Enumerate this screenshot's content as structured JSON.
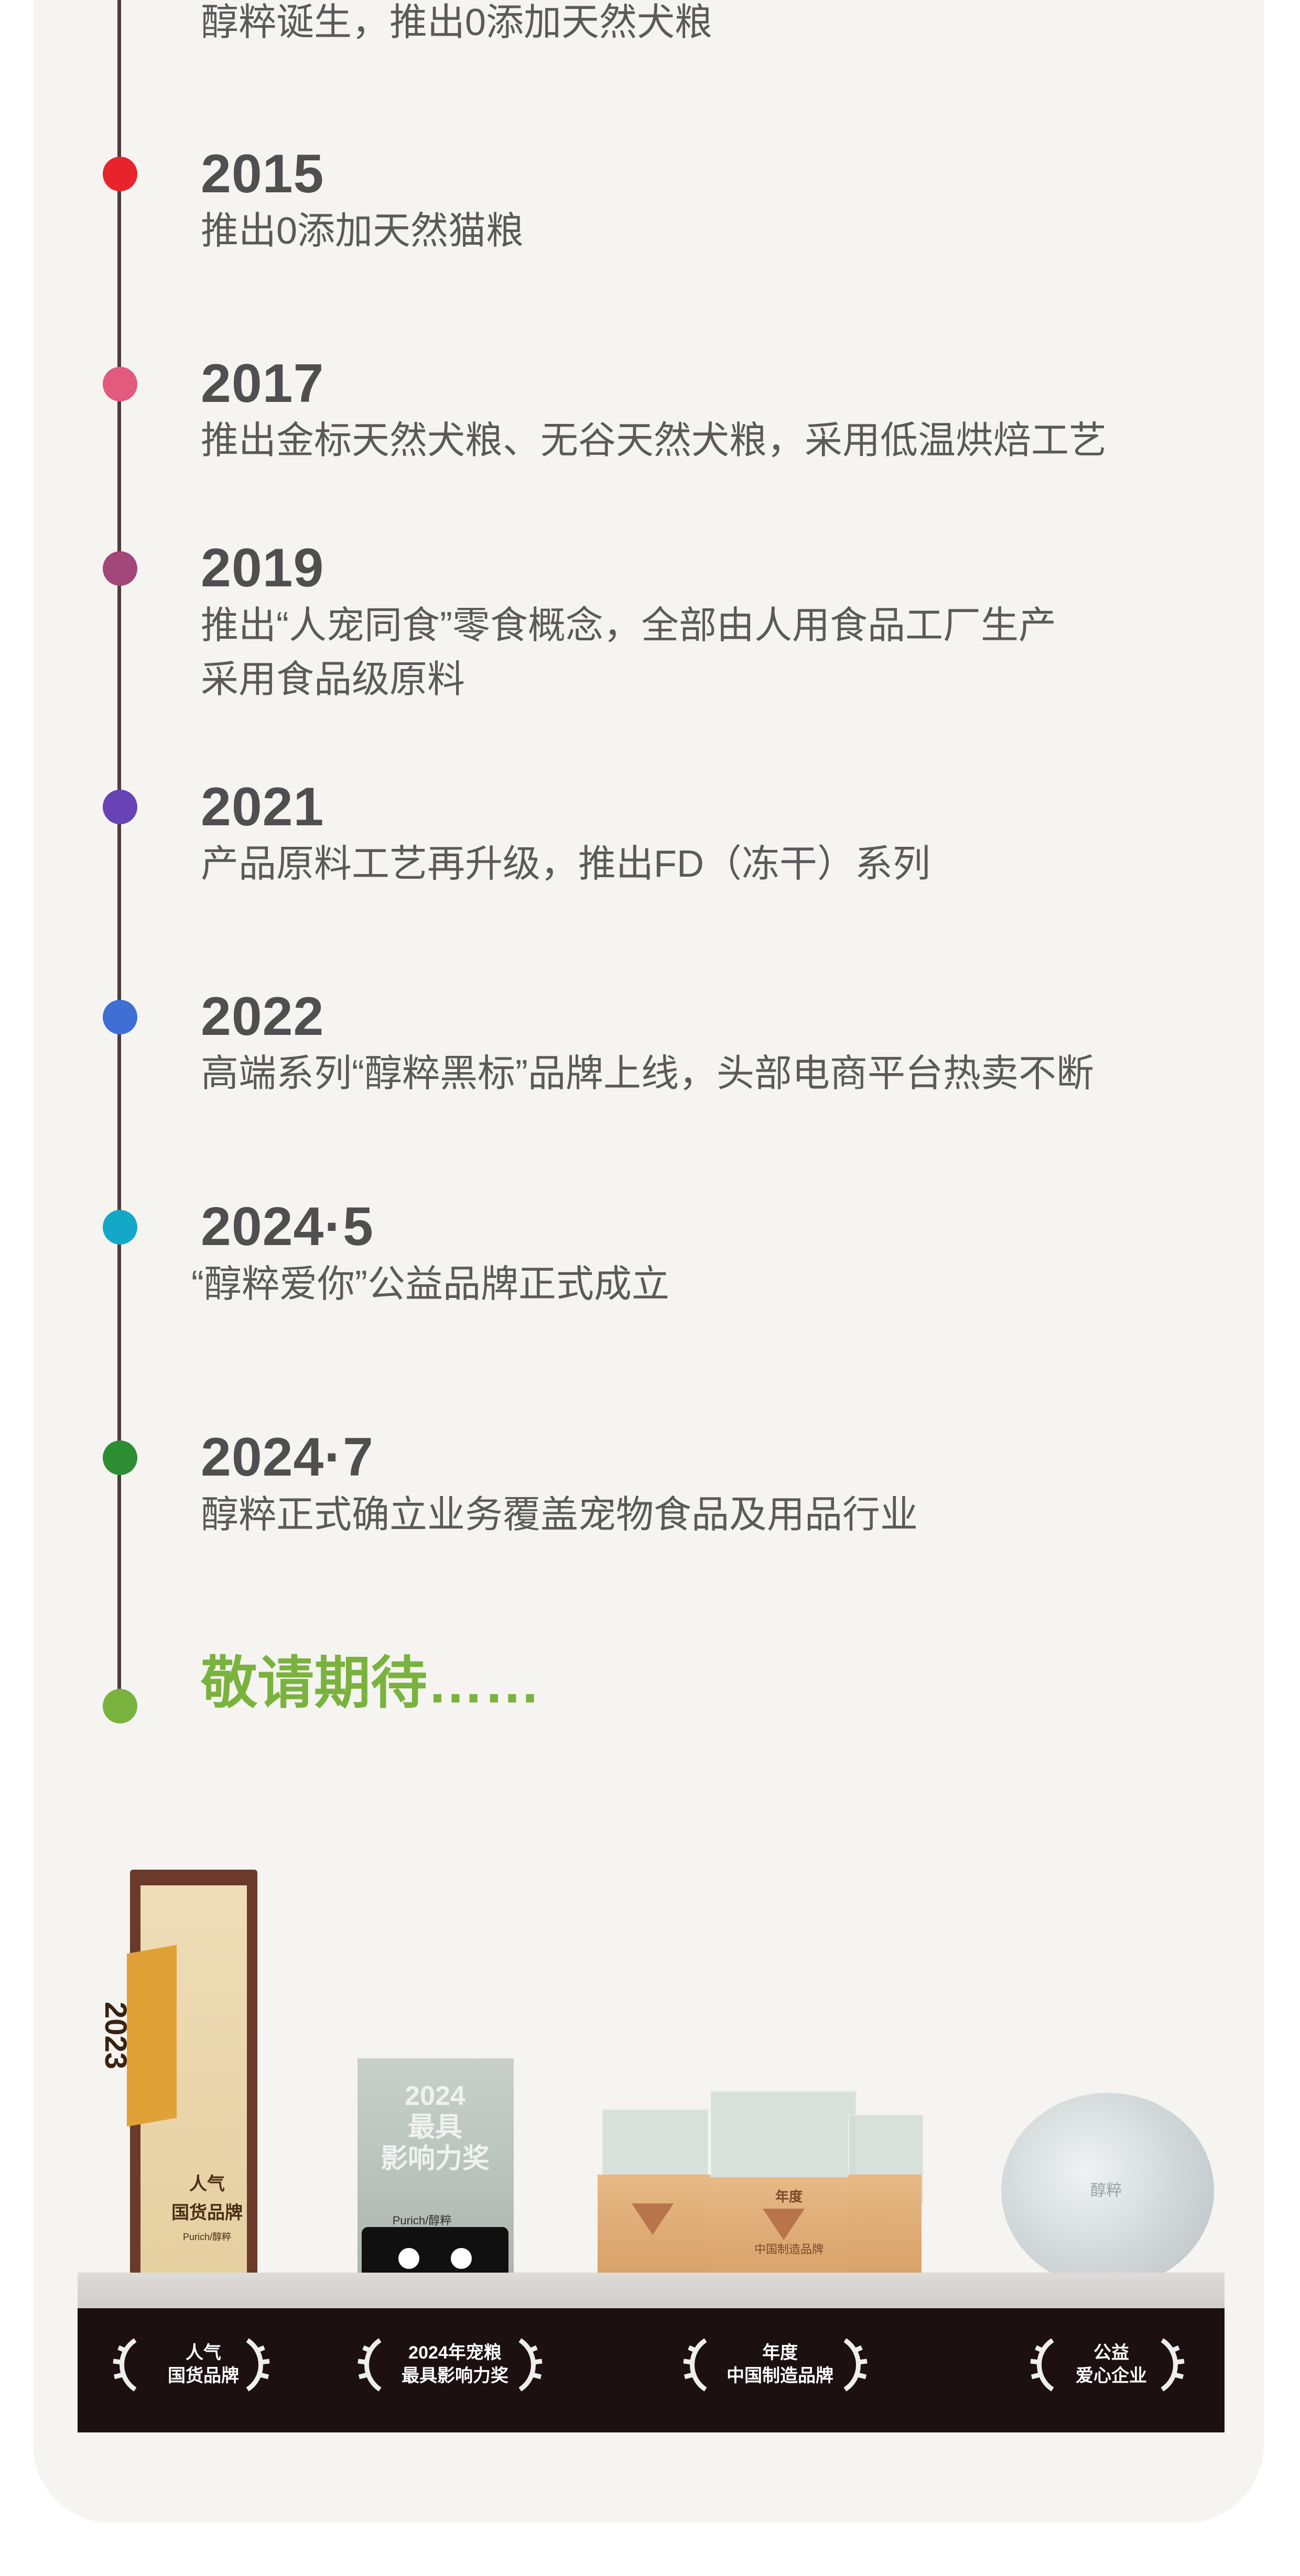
{
  "timeline": [
    {
      "year": "",
      "desc": "醇粹诞生，推出0添加天然犬粮",
      "color": ""
    },
    {
      "year": "2015",
      "desc": "推出0添加天然猫粮",
      "color": "#e8232c"
    },
    {
      "year": "2017",
      "desc": "推出金标天然犬粮、无谷天然犬粮，采用低温烘焙工艺",
      "color": "#e25a7e"
    },
    {
      "year": "2019",
      "desc": "推出“人宠同食”零食概念，全部由人用食品工厂生产",
      "desc2": "采用食品级原料",
      "color": "#a3477a"
    },
    {
      "year": "2021",
      "desc": "产品原料工艺再升级，推出FD（冻干）系列",
      "color": "#6743b6"
    },
    {
      "year": "2022",
      "desc": "高端系列“醇粹黑标”品牌上线，头部电商平台热卖不断",
      "color": "#3f6fd5"
    },
    {
      "year": "2024·5",
      "desc": "“醇粹爱你”公益品牌正式成立",
      "color": "#13a8c8"
    },
    {
      "year": "2024·7",
      "desc": "醇粹正式确立业务覆盖宠物食品及用品行业",
      "color": "#2d8d33"
    }
  ],
  "final": {
    "text": "敬请期待……",
    "color": "#7ab23e"
  },
  "trophies": {
    "t1": {
      "year": "2023",
      "line1": "人气",
      "line2": "国货品牌",
      "brand": "Purich/醇粹"
    },
    "t2": {
      "year": "2024",
      "line1": "最具",
      "line2": "影响力奖",
      "brand": "Purich/醇粹"
    },
    "t3": {
      "line1": "年度",
      "line2": "中国制造品牌"
    },
    "t4": {
      "line1": "醇粹"
    }
  },
  "awards": [
    {
      "line1": "人气",
      "line2": "国货品牌"
    },
    {
      "line1": "2024年宠粮",
      "line2": "最具影响力奖"
    },
    {
      "line1": "年度",
      "line2": "中国制造品牌"
    },
    {
      "line1": "公益",
      "line2": "爱心企业"
    }
  ]
}
